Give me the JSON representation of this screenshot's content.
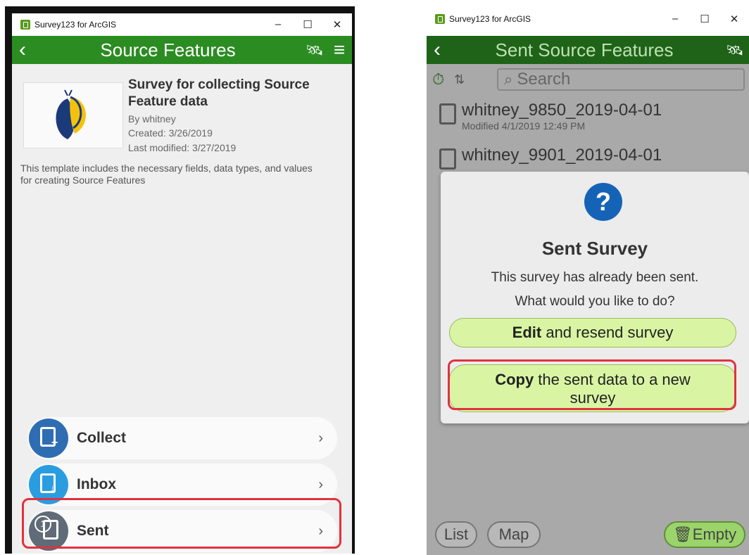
{
  "left_window": {
    "window_title": "Survey123 for ArcGIS",
    "controls": {
      "minimize": "–",
      "maximize": "☐",
      "close": "✕"
    },
    "header_title": "Source Features",
    "survey": {
      "title": "Survey for collecting Source Feature data",
      "author": "By whitney",
      "created": "Created: 3/26/2019",
      "modified": "Last modified: 3/27/2019",
      "description": "This template includes the necessary fields, data types, and values for creating Source Features"
    },
    "nav": [
      {
        "label": "Collect",
        "color": "#2f6db3"
      },
      {
        "label": "Inbox",
        "color": "#2a9de0"
      },
      {
        "label": "Sent",
        "color": "#5f6b77",
        "badge": "1"
      }
    ]
  },
  "right_window": {
    "window_title": "Survey123 for ArcGIS",
    "controls": {
      "minimize": "–",
      "maximize": "☐",
      "close": "✕"
    },
    "header_title": "Sent Source Features",
    "search_placeholder": "Search",
    "rows": [
      {
        "name": "whitney_9850_2019-04-01",
        "modified": "Modified 4/1/2019 12:49 PM"
      },
      {
        "name": "whitney_9901_2019-04-01"
      }
    ],
    "dialog": {
      "title": "Sent Survey",
      "line1": "This survey has already been sent.",
      "line2": "What would you like to do?",
      "btn1_bold": "Edit",
      "btn1_rest": " and resend survey",
      "btn2_bold": "Copy",
      "btn2_rest": " the sent data to a new survey"
    },
    "bottom": {
      "list": "List",
      "map": "Map",
      "empty": "Empty"
    }
  },
  "colors": {
    "appbar": "#2b8c22",
    "highlight": "#e0323e",
    "dialog_button": "#d9f5a3"
  }
}
